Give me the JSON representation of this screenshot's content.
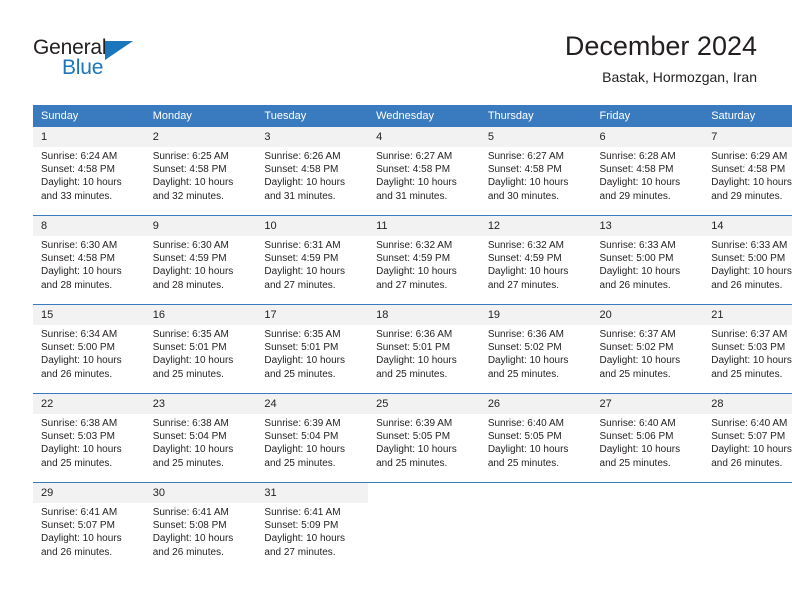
{
  "logo": {
    "general_text": "General",
    "blue_text": "Blue",
    "triangle_color": "#1b76bc"
  },
  "header": {
    "title": "December 2024",
    "subtitle": "Bastak, Hormozgan, Iran"
  },
  "theme": {
    "header_blue": "#3a7bbf",
    "daynum_bg": "#f2f2f2",
    "text": "#231f20"
  },
  "weekdays": [
    "Sunday",
    "Monday",
    "Tuesday",
    "Wednesday",
    "Thursday",
    "Friday",
    "Saturday"
  ],
  "weeks": [
    [
      {
        "day": "1",
        "sunrise": "Sunrise: 6:24 AM",
        "sunset": "Sunset: 4:58 PM",
        "daylight": "Daylight: 10 hours and 33 minutes."
      },
      {
        "day": "2",
        "sunrise": "Sunrise: 6:25 AM",
        "sunset": "Sunset: 4:58 PM",
        "daylight": "Daylight: 10 hours and 32 minutes."
      },
      {
        "day": "3",
        "sunrise": "Sunrise: 6:26 AM",
        "sunset": "Sunset: 4:58 PM",
        "daylight": "Daylight: 10 hours and 31 minutes."
      },
      {
        "day": "4",
        "sunrise": "Sunrise: 6:27 AM",
        "sunset": "Sunset: 4:58 PM",
        "daylight": "Daylight: 10 hours and 31 minutes."
      },
      {
        "day": "5",
        "sunrise": "Sunrise: 6:27 AM",
        "sunset": "Sunset: 4:58 PM",
        "daylight": "Daylight: 10 hours and 30 minutes."
      },
      {
        "day": "6",
        "sunrise": "Sunrise: 6:28 AM",
        "sunset": "Sunset: 4:58 PM",
        "daylight": "Daylight: 10 hours and 29 minutes."
      },
      {
        "day": "7",
        "sunrise": "Sunrise: 6:29 AM",
        "sunset": "Sunset: 4:58 PM",
        "daylight": "Daylight: 10 hours and 29 minutes."
      }
    ],
    [
      {
        "day": "8",
        "sunrise": "Sunrise: 6:30 AM",
        "sunset": "Sunset: 4:58 PM",
        "daylight": "Daylight: 10 hours and 28 minutes."
      },
      {
        "day": "9",
        "sunrise": "Sunrise: 6:30 AM",
        "sunset": "Sunset: 4:59 PM",
        "daylight": "Daylight: 10 hours and 28 minutes."
      },
      {
        "day": "10",
        "sunrise": "Sunrise: 6:31 AM",
        "sunset": "Sunset: 4:59 PM",
        "daylight": "Daylight: 10 hours and 27 minutes."
      },
      {
        "day": "11",
        "sunrise": "Sunrise: 6:32 AM",
        "sunset": "Sunset: 4:59 PM",
        "daylight": "Daylight: 10 hours and 27 minutes."
      },
      {
        "day": "12",
        "sunrise": "Sunrise: 6:32 AM",
        "sunset": "Sunset: 4:59 PM",
        "daylight": "Daylight: 10 hours and 27 minutes."
      },
      {
        "day": "13",
        "sunrise": "Sunrise: 6:33 AM",
        "sunset": "Sunset: 5:00 PM",
        "daylight": "Daylight: 10 hours and 26 minutes."
      },
      {
        "day": "14",
        "sunrise": "Sunrise: 6:33 AM",
        "sunset": "Sunset: 5:00 PM",
        "daylight": "Daylight: 10 hours and 26 minutes."
      }
    ],
    [
      {
        "day": "15",
        "sunrise": "Sunrise: 6:34 AM",
        "sunset": "Sunset: 5:00 PM",
        "daylight": "Daylight: 10 hours and 26 minutes."
      },
      {
        "day": "16",
        "sunrise": "Sunrise: 6:35 AM",
        "sunset": "Sunset: 5:01 PM",
        "daylight": "Daylight: 10 hours and 25 minutes."
      },
      {
        "day": "17",
        "sunrise": "Sunrise: 6:35 AM",
        "sunset": "Sunset: 5:01 PM",
        "daylight": "Daylight: 10 hours and 25 minutes."
      },
      {
        "day": "18",
        "sunrise": "Sunrise: 6:36 AM",
        "sunset": "Sunset: 5:01 PM",
        "daylight": "Daylight: 10 hours and 25 minutes."
      },
      {
        "day": "19",
        "sunrise": "Sunrise: 6:36 AM",
        "sunset": "Sunset: 5:02 PM",
        "daylight": "Daylight: 10 hours and 25 minutes."
      },
      {
        "day": "20",
        "sunrise": "Sunrise: 6:37 AM",
        "sunset": "Sunset: 5:02 PM",
        "daylight": "Daylight: 10 hours and 25 minutes."
      },
      {
        "day": "21",
        "sunrise": "Sunrise: 6:37 AM",
        "sunset": "Sunset: 5:03 PM",
        "daylight": "Daylight: 10 hours and 25 minutes."
      }
    ],
    [
      {
        "day": "22",
        "sunrise": "Sunrise: 6:38 AM",
        "sunset": "Sunset: 5:03 PM",
        "daylight": "Daylight: 10 hours and 25 minutes."
      },
      {
        "day": "23",
        "sunrise": "Sunrise: 6:38 AM",
        "sunset": "Sunset: 5:04 PM",
        "daylight": "Daylight: 10 hours and 25 minutes."
      },
      {
        "day": "24",
        "sunrise": "Sunrise: 6:39 AM",
        "sunset": "Sunset: 5:04 PM",
        "daylight": "Daylight: 10 hours and 25 minutes."
      },
      {
        "day": "25",
        "sunrise": "Sunrise: 6:39 AM",
        "sunset": "Sunset: 5:05 PM",
        "daylight": "Daylight: 10 hours and 25 minutes."
      },
      {
        "day": "26",
        "sunrise": "Sunrise: 6:40 AM",
        "sunset": "Sunset: 5:05 PM",
        "daylight": "Daylight: 10 hours and 25 minutes."
      },
      {
        "day": "27",
        "sunrise": "Sunrise: 6:40 AM",
        "sunset": "Sunset: 5:06 PM",
        "daylight": "Daylight: 10 hours and 25 minutes."
      },
      {
        "day": "28",
        "sunrise": "Sunrise: 6:40 AM",
        "sunset": "Sunset: 5:07 PM",
        "daylight": "Daylight: 10 hours and 26 minutes."
      }
    ],
    [
      {
        "day": "29",
        "sunrise": "Sunrise: 6:41 AM",
        "sunset": "Sunset: 5:07 PM",
        "daylight": "Daylight: 10 hours and 26 minutes."
      },
      {
        "day": "30",
        "sunrise": "Sunrise: 6:41 AM",
        "sunset": "Sunset: 5:08 PM",
        "daylight": "Daylight: 10 hours and 26 minutes."
      },
      {
        "day": "31",
        "sunrise": "Sunrise: 6:41 AM",
        "sunset": "Sunset: 5:09 PM",
        "daylight": "Daylight: 10 hours and 27 minutes."
      },
      {
        "day": "",
        "sunrise": "",
        "sunset": "",
        "daylight": ""
      },
      {
        "day": "",
        "sunrise": "",
        "sunset": "",
        "daylight": ""
      },
      {
        "day": "",
        "sunrise": "",
        "sunset": "",
        "daylight": ""
      },
      {
        "day": "",
        "sunrise": "",
        "sunset": "",
        "daylight": ""
      }
    ]
  ]
}
